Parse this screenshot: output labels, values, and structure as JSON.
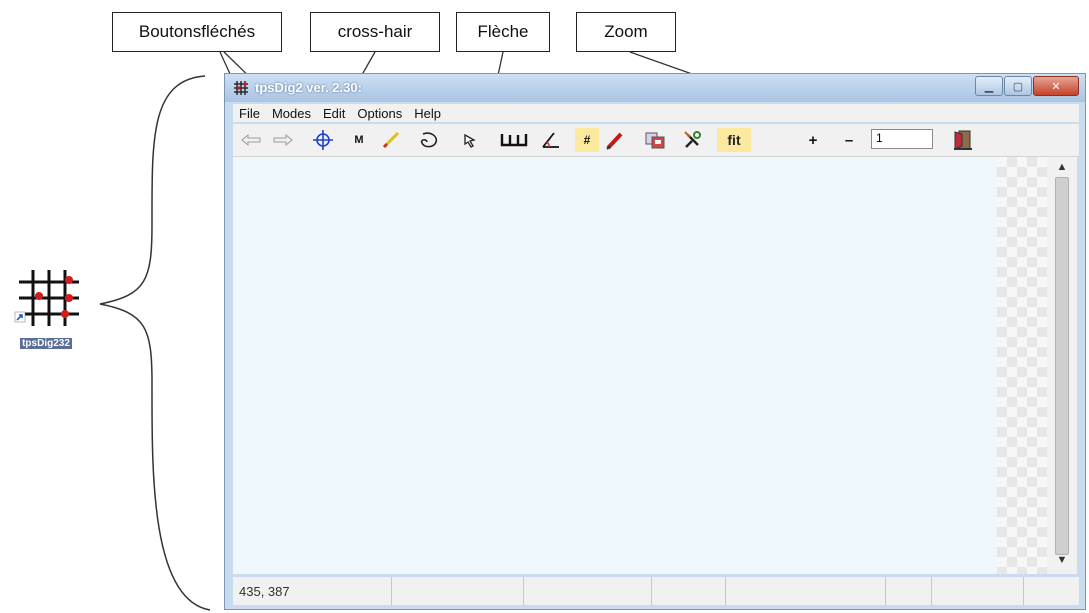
{
  "callouts": {
    "arrows_label": "Boutonsfléchés",
    "crosshair_label": "cross-hair",
    "arrow_label": "Flèche",
    "zoom_label": "Zoom"
  },
  "desktop_icon": {
    "label": "tpsDig232",
    "icon": "tpsdig-app-icon"
  },
  "window": {
    "title": "tpsDig2 ver. 2.30:",
    "controls": [
      "minimize",
      "maximize",
      "close"
    ]
  },
  "menu": [
    "File",
    "Modes",
    "Edit",
    "Options",
    "Help"
  ],
  "toolbar": {
    "marker_label": "M",
    "grid_label": "#",
    "fit_label": "fit",
    "zoom_in_label": "+",
    "zoom_out_label": "–",
    "zoom_value": "1"
  },
  "status": {
    "coords": "435, 387"
  },
  "colors": {
    "canvas_bg": "#eef8fc",
    "highlight": "#fbe9a0",
    "titlebar": "#a9c4e2"
  }
}
